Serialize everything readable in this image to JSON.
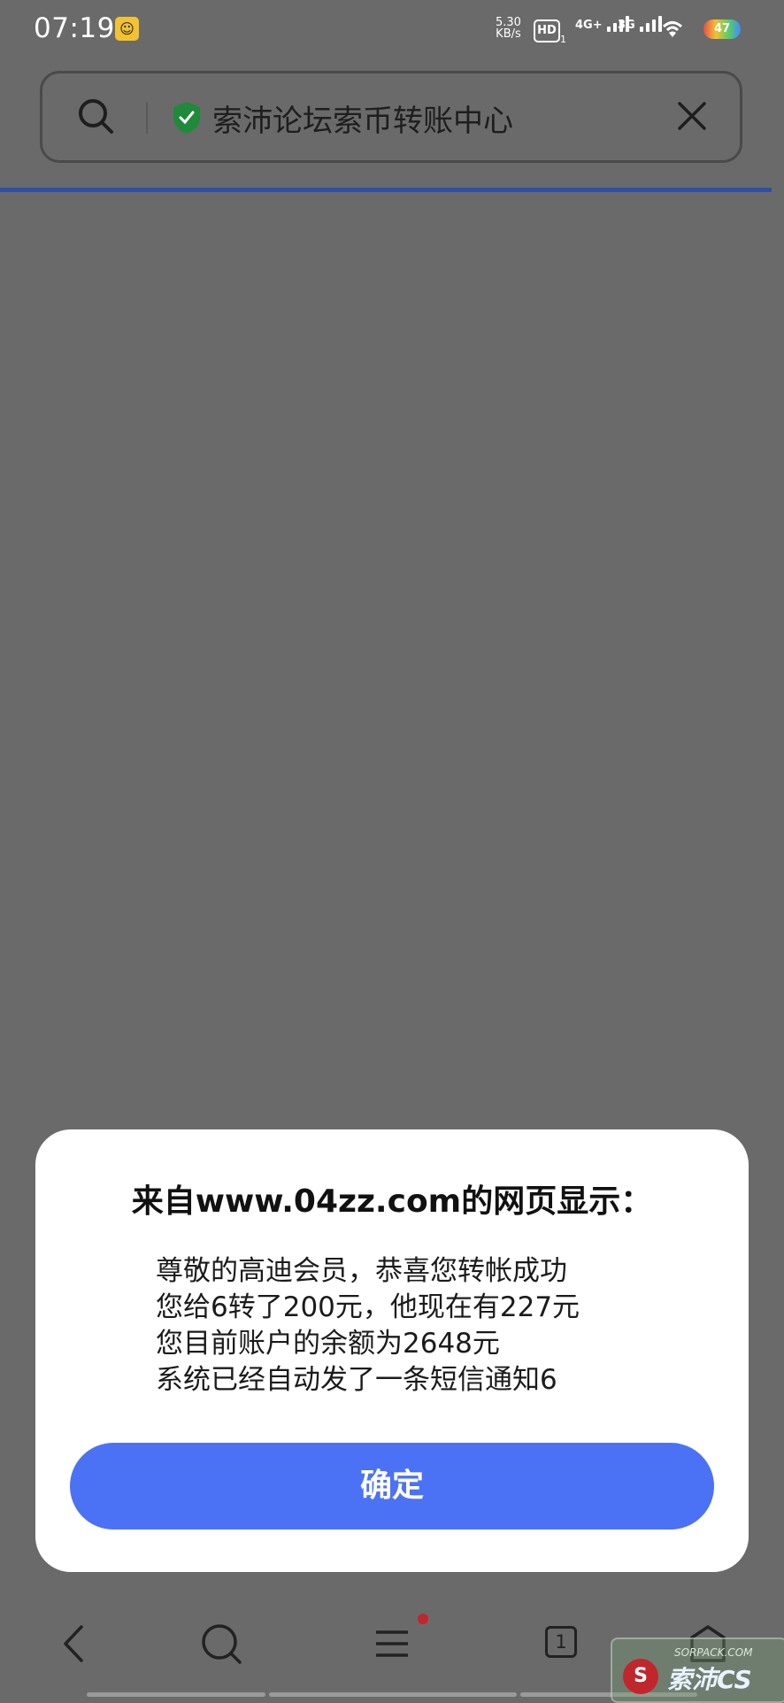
{
  "status_bar": {
    "time": "07:19",
    "speed_value": "5.30",
    "speed_unit": "KB/s",
    "hd": "HD",
    "hd_sub": "1",
    "net1": "4G+",
    "net2": "3G",
    "battery": "47"
  },
  "address_bar": {
    "title": "索沛论坛索币转账中心"
  },
  "dialog": {
    "title": "来自www.04zz.com的网页显示：",
    "lines": [
      "尊敬的高迪会员，恭喜您转帐成功",
      "您给6转了200元，他现在有227元",
      "您目前账户的余额为2648元",
      "系统已经自动发了一条短信通知6"
    ],
    "confirm_label": "确定"
  },
  "bottom_nav": {
    "tab_count": "1"
  },
  "watermark": {
    "site": "SORPACK.COM",
    "logo": "S",
    "name": "索沛CS"
  },
  "colors": {
    "overlay": "#6a6a6a",
    "primary_button": "#4b72f5",
    "shield": "#1f8a3a",
    "notification_dot": "#c0262c"
  }
}
